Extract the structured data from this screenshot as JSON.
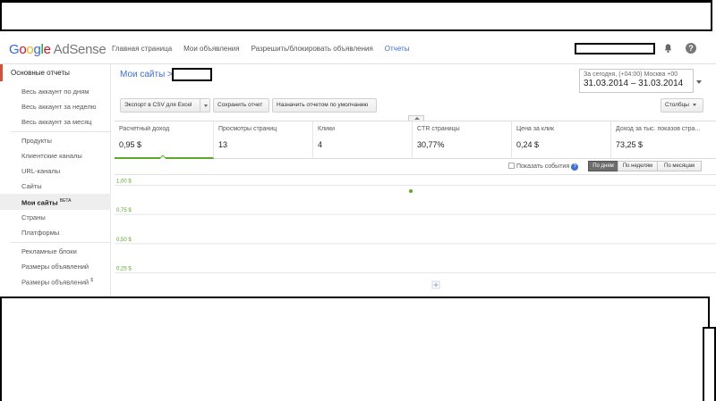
{
  "brand": {
    "google": [
      "G",
      "o",
      "o",
      "g",
      "l",
      "e"
    ],
    "product": "AdSense"
  },
  "nav": [
    {
      "label": "Главная страница",
      "active": false
    },
    {
      "label": "Мои объявления",
      "active": false
    },
    {
      "label": "Разрешить/блокировать объявления",
      "active": false
    },
    {
      "label": "Отчеты",
      "active": true
    }
  ],
  "sidebar": {
    "main": "Основные отчеты",
    "group1": [
      "Весь аккаунт по дням",
      "Весь аккаунт за неделю",
      "Весь аккаунт за месяц"
    ],
    "group2": [
      "Продукты",
      "Клиентские каналы",
      "URL-каналы",
      "Сайты"
    ],
    "active_item": {
      "label": "Мои сайты",
      "badge": "BETA"
    },
    "group3": [
      "Страны",
      "Платформы"
    ],
    "group4": [
      "Рекламные блоки",
      "Размеры объявлений",
      "Размеры объявлений"
    ],
    "group4_badge": "$"
  },
  "breadcrumb": {
    "label": "Мои сайты >"
  },
  "date_range": {
    "timezone": "За сегодня, (+04:00) Москва +00",
    "range": "31.03.2014 – 31.03.2014"
  },
  "toolbar": {
    "export": "Экспорт в CSV для Excel",
    "save": "Сохранить отчет",
    "default": "Назначить отчетом по умолчанию",
    "columns": "Столбцы"
  },
  "metrics": [
    {
      "label": "Расчетный доход",
      "value": "0,95 $",
      "active": true
    },
    {
      "label": "Просмотры страниц",
      "value": "13",
      "active": false
    },
    {
      "label": "Клики",
      "value": "4",
      "active": false
    },
    {
      "label": "CTR страницы",
      "value": "30,77%",
      "active": false
    },
    {
      "label": "Цена за клик",
      "value": "0,24 $",
      "active": false
    },
    {
      "label": "Доход за тыс. показов стра...",
      "value": "73,25 $",
      "active": false
    }
  ],
  "chart_controls": {
    "show_events": "Показать события",
    "help": "?",
    "periods": [
      {
        "label": "По дням",
        "active": true
      },
      {
        "label": "По неделям",
        "active": false
      },
      {
        "label": "По месяцам",
        "active": false
      }
    ]
  },
  "chart_data": {
    "type": "scatter",
    "title": "",
    "xlabel": "",
    "ylabel": "",
    "yticks": [
      "1,00 $",
      "0,75 $",
      "0,50 $",
      "0,25 $"
    ],
    "ylim": [
      0,
      1.05
    ],
    "points": [
      {
        "x": "31.03.2014",
        "y": 0.95
      }
    ],
    "grid": true,
    "color": "#5aa92d"
  },
  "colors": {
    "accent": "#5aa92d",
    "link": "#3d6fd6",
    "sidebar_marker": "#dd4b39"
  }
}
